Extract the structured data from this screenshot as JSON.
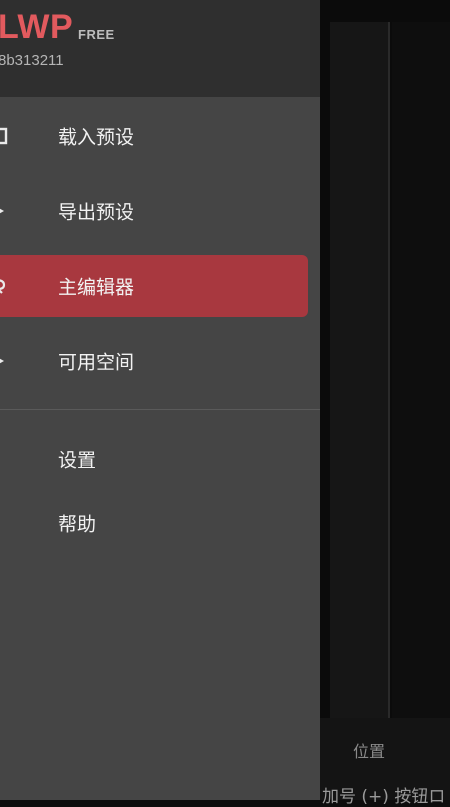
{
  "drawer": {
    "app_name": "LWP",
    "edition": "FREE",
    "id_text": "8b313211",
    "items": [
      {
        "label": "载入预设",
        "icon": "folder-icon"
      },
      {
        "label": "导出预设",
        "icon": "export-icon"
      },
      {
        "label": "主编辑器",
        "icon": "editor-icon",
        "active": true
      },
      {
        "label": "可用空间",
        "icon": "storage-icon"
      }
    ],
    "secondary_items": [
      {
        "label": "设置",
        "icon": "gear-icon"
      },
      {
        "label": "帮助",
        "icon": "help-icon"
      }
    ]
  },
  "background": {
    "position_label": "位置",
    "hint_text": "加号 (+) 按钮ロ"
  },
  "colors": {
    "accent": "#e25a5e",
    "active_bg": "#a8383f",
    "drawer_bg": "#454545",
    "header_bg": "#2f2f2f"
  }
}
